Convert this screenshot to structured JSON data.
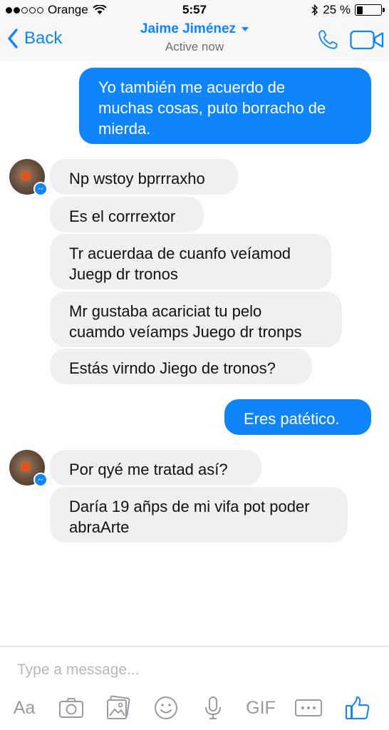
{
  "status_bar": {
    "carrier": "Orange",
    "time": "5:57",
    "battery": "25 %",
    "battery_level": 0.25,
    "signal_bars_filled": 2,
    "signal_bars_total": 5
  },
  "nav": {
    "back_label": "Back",
    "contact_name": "Jaime Jiménez",
    "status": "Active now"
  },
  "messages": [
    {
      "direction": "out",
      "text": "Yo también me acuerdo de\nmuchas cosas, puto borracho de\nmierda."
    },
    {
      "direction": "in",
      "text": "Np wstoy bprrraxho"
    },
    {
      "direction": "in",
      "text": "Es el corrrextor"
    },
    {
      "direction": "in",
      "text": "Tr acuerdaa de cuanfo veíamod\nJuegp dr tronos"
    },
    {
      "direction": "in",
      "text": "Mr gustaba acariciat tu pelo\ncuamdo veíamps Juego dr tronps"
    },
    {
      "direction": "in",
      "text": "Estás virndo Jiego de tronos?"
    },
    {
      "direction": "out",
      "text": "Eres patético."
    },
    {
      "direction": "in",
      "text": "Por qyé me tratad así?"
    },
    {
      "direction": "in",
      "text": "Daría 19 añps de mi vifa pot poder\nabraArte"
    }
  ],
  "composer": {
    "placeholder": "Type a message...",
    "text_tool_label": "Aa",
    "gif_label": "GIF"
  },
  "colors": {
    "accent": "#0f84fb",
    "incoming_bubble": "#f0f0f2",
    "icon_gray": "#9a9aa0"
  },
  "icons": [
    "back-chevron-icon",
    "phone-icon",
    "video-camera-icon",
    "messenger-badge-icon",
    "camera-icon",
    "photo-icon",
    "emoji-icon",
    "microphone-icon",
    "more-icon",
    "thumbs-up-icon"
  ]
}
